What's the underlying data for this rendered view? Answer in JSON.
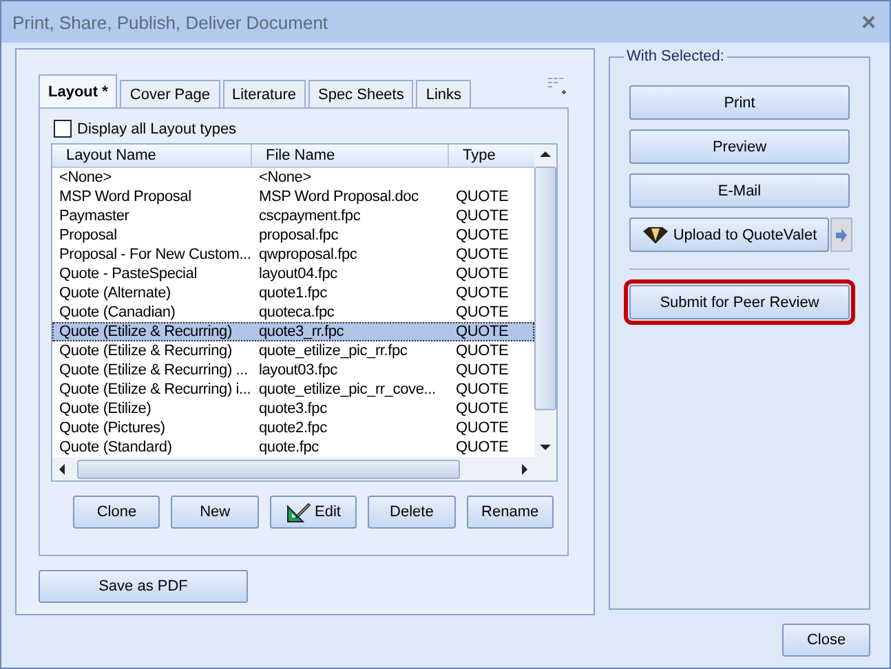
{
  "window": {
    "title": "Print, Share, Publish, Deliver Document",
    "close": "×"
  },
  "tabs": [
    {
      "label": "Layout *",
      "selected": true
    },
    {
      "label": "Cover Page",
      "selected": false
    },
    {
      "label": "Literature",
      "selected": false
    },
    {
      "label": "Spec Sheets",
      "selected": false
    },
    {
      "label": "Links",
      "selected": false
    }
  ],
  "display_all": {
    "label": "Display all Layout types",
    "checked": false
  },
  "table": {
    "columns": [
      "Layout Name",
      "File Name",
      "Type"
    ],
    "rows": [
      {
        "cells": [
          "<None>",
          "<None>",
          ""
        ],
        "selected": false
      },
      {
        "cells": [
          "MSP Word Proposal",
          "MSP Word Proposal.doc",
          "QUOTE"
        ],
        "selected": false
      },
      {
        "cells": [
          "Paymaster",
          "cscpayment.fpc",
          "QUOTE"
        ],
        "selected": false
      },
      {
        "cells": [
          "Proposal",
          "proposal.fpc",
          "QUOTE"
        ],
        "selected": false
      },
      {
        "cells": [
          "Proposal - For New Custom...",
          "qwproposal.fpc",
          "QUOTE"
        ],
        "selected": false
      },
      {
        "cells": [
          "Quote - PasteSpecial",
          "layout04.fpc",
          "QUOTE"
        ],
        "selected": false
      },
      {
        "cells": [
          "Quote (Alternate)",
          "quote1.fpc",
          "QUOTE"
        ],
        "selected": false
      },
      {
        "cells": [
          "Quote (Canadian)",
          "quoteca.fpc",
          "QUOTE"
        ],
        "selected": false
      },
      {
        "cells": [
          "Quote (Etilize & Recurring)",
          "quote3_rr.fpc",
          "QUOTE"
        ],
        "selected": true
      },
      {
        "cells": [
          "Quote (Etilize & Recurring)",
          "quote_etilize_pic_rr.fpc",
          "QUOTE"
        ],
        "selected": false
      },
      {
        "cells": [
          "Quote (Etilize & Recurring) ...",
          "layout03.fpc",
          "QUOTE"
        ],
        "selected": false
      },
      {
        "cells": [
          "Quote (Etilize & Recurring) i...",
          "quote_etilize_pic_rr_cove...",
          "QUOTE"
        ],
        "selected": false
      },
      {
        "cells": [
          "Quote (Etilize)",
          "quote3.fpc",
          "QUOTE"
        ],
        "selected": false
      },
      {
        "cells": [
          "Quote (Pictures)",
          "quote2.fpc",
          "QUOTE"
        ],
        "selected": false
      },
      {
        "cells": [
          "Quote (Standard)",
          "quote.fpc",
          "QUOTE"
        ],
        "selected": false
      }
    ]
  },
  "list_buttons": [
    {
      "label": "Clone",
      "kind": "plain"
    },
    {
      "label": "New",
      "kind": "plain"
    },
    {
      "label": "Edit",
      "kind": "icon"
    },
    {
      "label": "Delete",
      "kind": "plain"
    },
    {
      "label": "Rename",
      "kind": "plain"
    }
  ],
  "save_pdf": "Save as PDF",
  "with_selected": {
    "title": "With Selected:",
    "buttons": [
      {
        "label": "Print",
        "kind": "plain"
      },
      {
        "label": "Preview",
        "kind": "plain"
      },
      {
        "label": "E-Mail",
        "kind": "plain"
      },
      {
        "label": "Upload to QuoteValet",
        "kind": "split"
      }
    ],
    "review": {
      "label": "Submit for Peer Review",
      "highlighted": true
    }
  },
  "close_button": "Close"
}
